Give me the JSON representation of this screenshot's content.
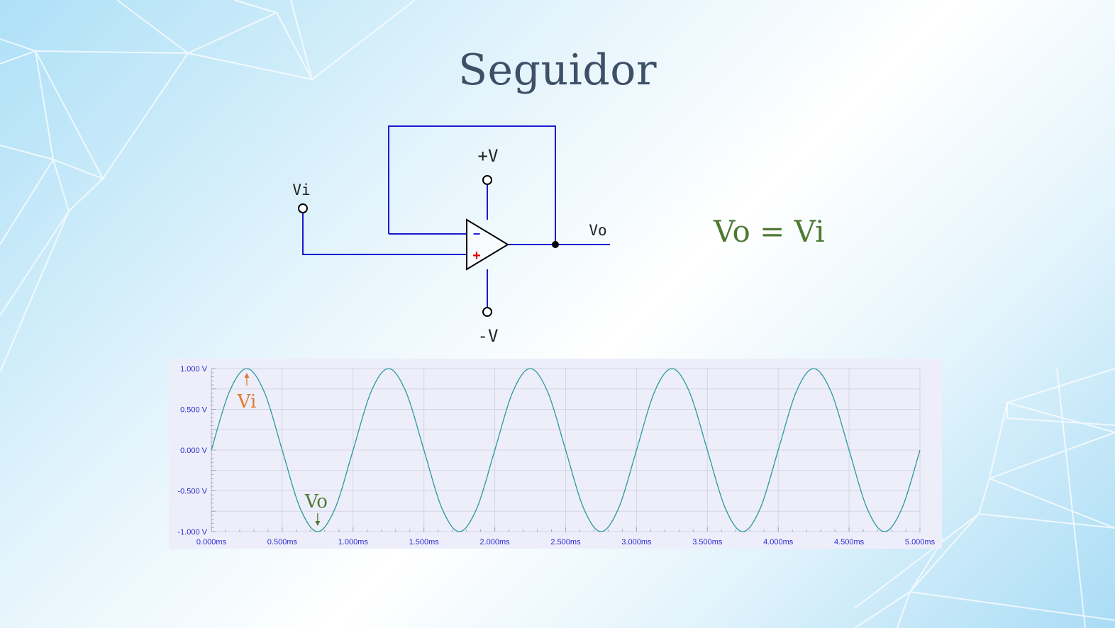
{
  "slide": {
    "title": "Seguidor",
    "equation": "Vo = Vi",
    "equation_color": "#4e7a33"
  },
  "circuit": {
    "labels": {
      "vi": "Vi",
      "vo": "Vo",
      "vplus": "+V",
      "vminus": "-V",
      "inv": "−",
      "noninv": "+"
    },
    "wire_color": "#1a1ad0",
    "plus_color": "#e00000"
  },
  "chart_data": {
    "type": "line",
    "x": [
      0.0,
      0.125,
      0.25,
      0.375,
      0.5,
      0.625,
      0.75,
      0.875,
      1.0,
      1.125,
      1.25,
      1.375,
      1.5,
      1.625,
      1.75,
      1.875,
      2.0,
      2.125,
      2.25,
      2.375,
      2.5,
      2.625,
      2.75,
      2.875,
      3.0,
      3.125,
      3.25,
      3.375,
      3.5,
      3.625,
      3.75,
      3.875,
      4.0,
      4.125,
      4.25,
      4.375,
      4.5,
      4.625,
      4.75,
      4.875,
      5.0
    ],
    "y": [
      0.0,
      0.707,
      1.0,
      0.707,
      0.0,
      -0.707,
      -1.0,
      -0.707,
      0.0,
      0.707,
      1.0,
      0.707,
      0.0,
      -0.707,
      -1.0,
      -0.707,
      0.0,
      0.707,
      1.0,
      0.707,
      0.0,
      -0.707,
      -1.0,
      -0.707,
      0.0,
      0.707,
      1.0,
      0.707,
      0.0,
      -0.707,
      -1.0,
      -0.707,
      0.0,
      0.707,
      1.0,
      0.707,
      0.0,
      -0.707,
      -1.0,
      -0.707,
      0.0
    ],
    "xlim": [
      0,
      5
    ],
    "ylim": [
      -1,
      1
    ],
    "xticks": [
      "0.000ms",
      "0.500ms",
      "1.000ms",
      "1.500ms",
      "2.000ms",
      "2.500ms",
      "3.000ms",
      "3.500ms",
      "4.000ms",
      "4.500ms",
      "5.000ms"
    ],
    "yticks": [
      "1.000 V",
      "0.500 V",
      "0.000 V",
      "-0.500 V",
      "-1.000 V"
    ],
    "grid": true,
    "line_color": "#2a9a9a",
    "tick_color": "#2a2ad0",
    "annotations": [
      {
        "text": "Vi",
        "x": 0.25,
        "y": 1.0,
        "color": "#e07a30",
        "direction": "up"
      },
      {
        "text": "Vo",
        "x": 0.75,
        "y": -1.0,
        "color": "#4e7a33",
        "direction": "down"
      }
    ]
  }
}
